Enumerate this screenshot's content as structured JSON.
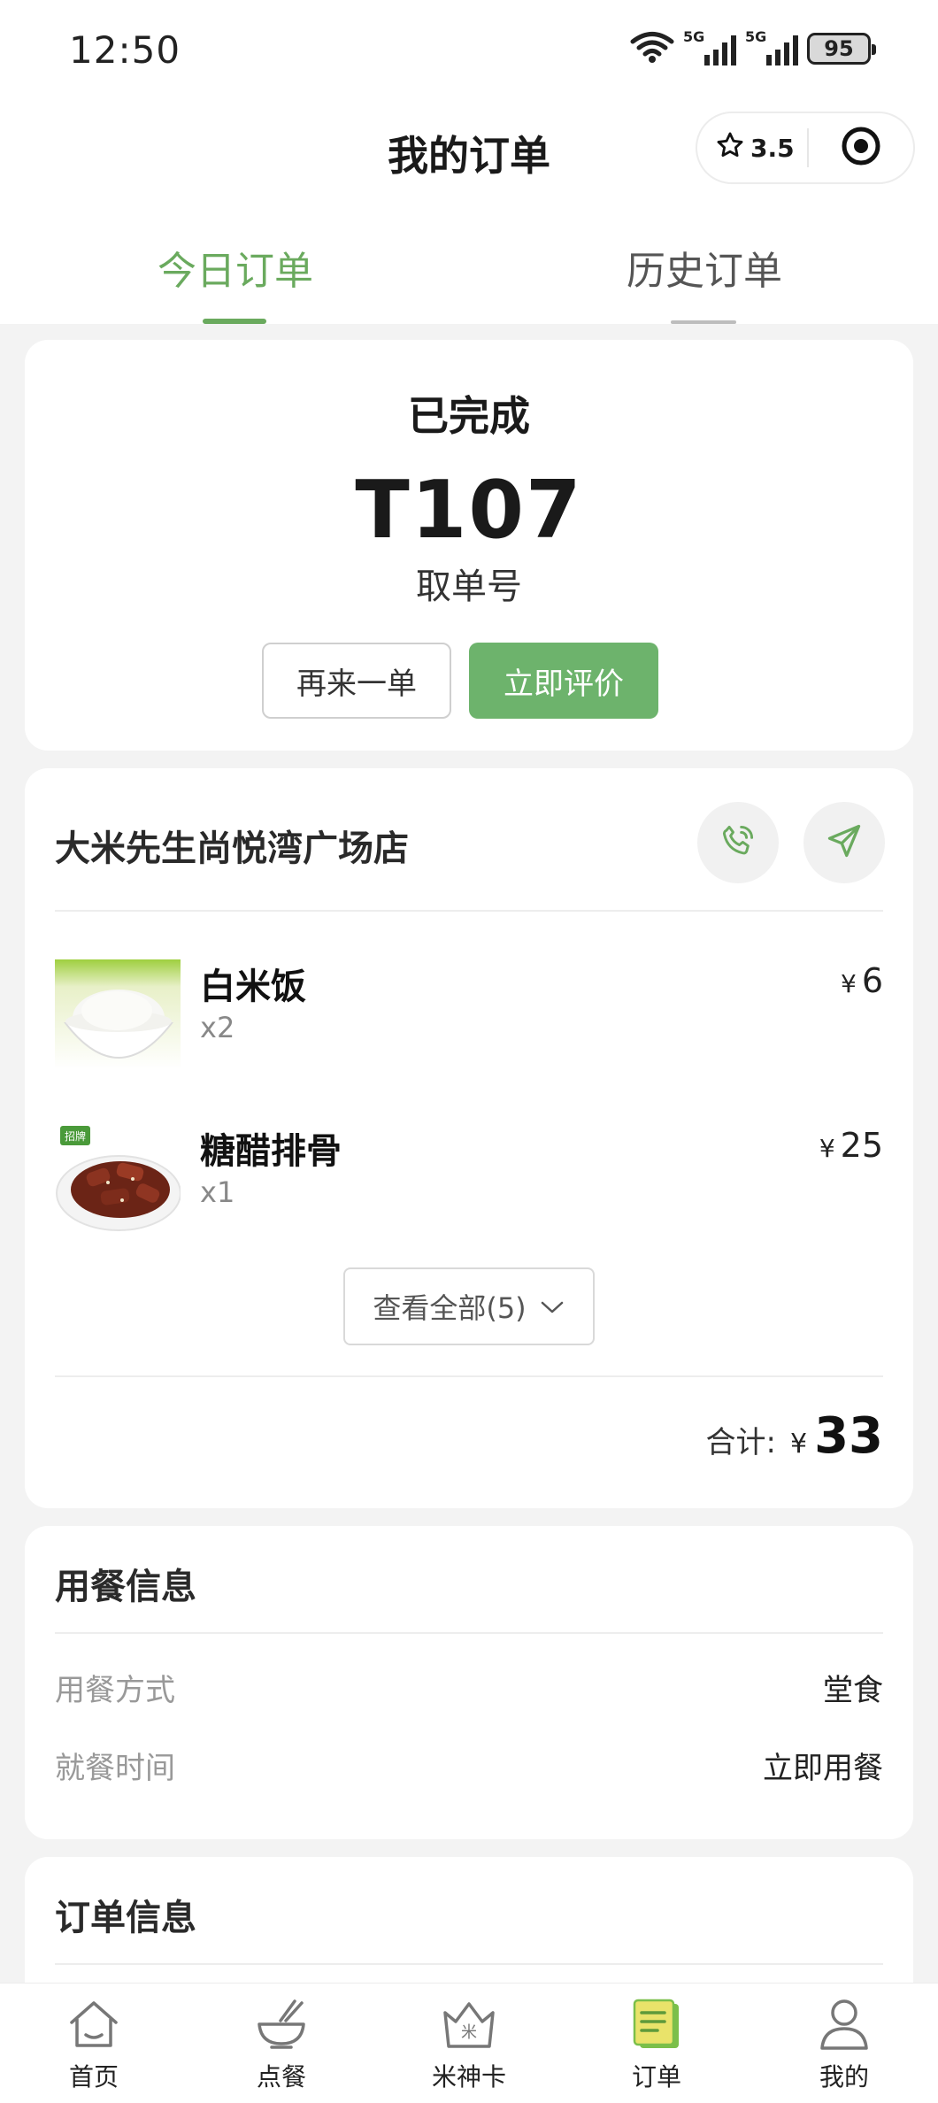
{
  "status_bar": {
    "time": "12:50",
    "signal_1": "5G",
    "signal_2": "5G",
    "battery": "95"
  },
  "header": {
    "title": "我的订单",
    "rating": "3.5"
  },
  "tabs": {
    "today": "今日订单",
    "history": "历史订单"
  },
  "order_status": {
    "status": "已完成",
    "pickup_code": "T107",
    "pickup_label": "取单号",
    "reorder_label": "再来一单",
    "review_label": "立即评价"
  },
  "store": {
    "name": "大米先生尚悦湾广场店",
    "items": [
      {
        "name": "白米饭",
        "qty": "x2",
        "currency": "¥",
        "price": "6"
      },
      {
        "name": "糖醋排骨",
        "qty": "x1",
        "currency": "¥",
        "price": "25",
        "badge": "招牌"
      }
    ],
    "view_all_label": "查看全部(5)",
    "total_label": "合计:",
    "total_currency": "¥",
    "total_amount": "33"
  },
  "dining": {
    "title": "用餐信息",
    "rows": [
      {
        "key": "用餐方式",
        "value": "堂食"
      },
      {
        "key": "就餐时间",
        "value": "立即用餐"
      }
    ]
  },
  "order_info": {
    "title": "订单信息"
  },
  "tabbar": {
    "items": [
      {
        "label": "首页",
        "icon": "home-icon"
      },
      {
        "label": "点餐",
        "icon": "bowl-icon"
      },
      {
        "label": "米神卡",
        "icon": "crown-card-icon"
      },
      {
        "label": "订单",
        "icon": "order-list-icon"
      },
      {
        "label": "我的",
        "icon": "user-icon"
      }
    ]
  },
  "colors": {
    "accent": "#6aaa5e",
    "button_green": "#6db36c",
    "background": "#f3f3f3"
  }
}
